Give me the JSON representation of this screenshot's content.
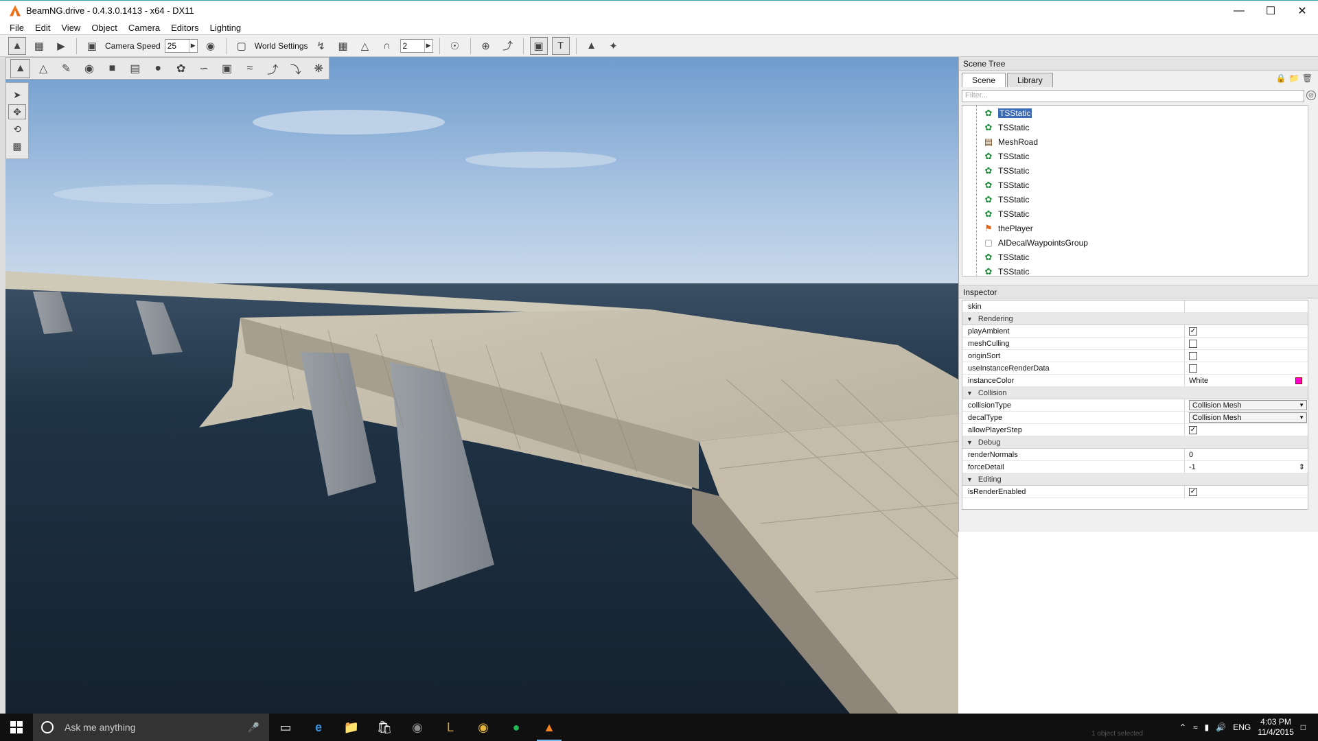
{
  "window": {
    "title": "BeamNG.drive - 0.4.3.0.1413 - x64 - DX11",
    "controls": [
      "minimize",
      "maximize",
      "close"
    ]
  },
  "menu": [
    "File",
    "Edit",
    "View",
    "Object",
    "Camera",
    "Editors",
    "Lighting"
  ],
  "toolbar": {
    "camera_speed_label": "Camera Speed",
    "camera_speed_value": "25",
    "world_settings_label": "World Settings",
    "snap_value": "2"
  },
  "scene_tree": {
    "title": "Scene Tree",
    "tabs": [
      "Scene",
      "Library"
    ],
    "filter_placeholder": "Filter...",
    "items": [
      {
        "label": "TSStatic",
        "icon": "tsstatic-icon",
        "selected": true
      },
      {
        "label": "TSStatic",
        "icon": "tsstatic-icon"
      },
      {
        "label": "MeshRoad",
        "icon": "meshroad-icon"
      },
      {
        "label": "TSStatic",
        "icon": "tsstatic-icon"
      },
      {
        "label": "TSStatic",
        "icon": "tsstatic-icon"
      },
      {
        "label": "TSStatic",
        "icon": "tsstatic-icon"
      },
      {
        "label": "TSStatic",
        "icon": "tsstatic-icon"
      },
      {
        "label": "TSStatic",
        "icon": "tsstatic-icon"
      },
      {
        "label": "thePlayer",
        "icon": "player-icon"
      },
      {
        "label": "AIDecalWaypointsGroup",
        "icon": "folder-icon"
      },
      {
        "label": "TSStatic",
        "icon": "tsstatic-icon"
      },
      {
        "label": "TSStatic",
        "icon": "tsstatic-icon"
      }
    ]
  },
  "inspector": {
    "title": "Inspector",
    "skin_label": "skin",
    "groups": {
      "rendering": "Rendering",
      "collision": "Collision",
      "debug": "Debug",
      "editing": "Editing"
    },
    "fields": {
      "playAmbient": {
        "label": "playAmbient",
        "checked": true
      },
      "meshCulling": {
        "label": "meshCulling",
        "checked": false
      },
      "originSort": {
        "label": "originSort",
        "checked": false
      },
      "useInstanceRenderData": {
        "label": "useInstanceRenderData",
        "checked": false
      },
      "instanceColor": {
        "label": "instanceColor",
        "value": "White",
        "swatch": "#ff00d4"
      },
      "collisionType": {
        "label": "collisionType",
        "value": "Collision Mesh"
      },
      "decalType": {
        "label": "decalType",
        "value": "Collision Mesh"
      },
      "allowPlayerStep": {
        "label": "allowPlayerStep",
        "checked": true
      },
      "renderNormals": {
        "label": "renderNormals",
        "value": "0"
      },
      "forceDetail": {
        "label": "forceDetail",
        "value": "-1"
      },
      "isRenderEnabled": {
        "label": "isRenderEnabled",
        "checked": true
      }
    }
  },
  "taskbar": {
    "search_placeholder": "Ask me anything",
    "language": "ENG",
    "time": "4:03 PM",
    "date": "11/4/2015",
    "status_text": "1 object selected"
  },
  "colors": {
    "water": "#1d2c3b",
    "sky_top": "#6f9ccd",
    "bridge": "#c8c0ae",
    "selection": "#3b6bb5"
  }
}
